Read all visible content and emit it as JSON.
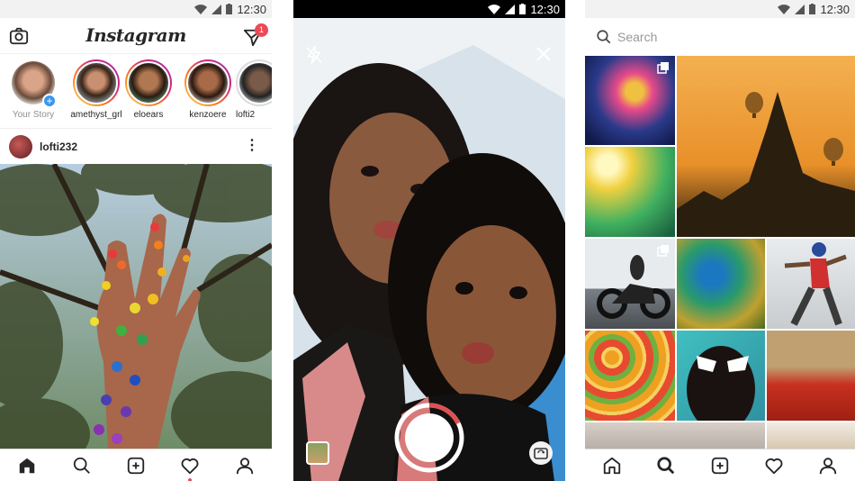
{
  "status_bar": {
    "time": "12:30"
  },
  "feed": {
    "app_title": "Instagram",
    "dm_badge_count": "1",
    "stories": [
      {
        "name": "Your Story"
      },
      {
        "name": "amethyst_grl"
      },
      {
        "name": "eloears"
      },
      {
        "name": "kenzoere"
      },
      {
        "name": "lofti2"
      }
    ],
    "post": {
      "username": "lofti232",
      "more_label": "⋮"
    }
  },
  "camera": {},
  "explore": {
    "search_placeholder": "Search"
  },
  "icons": [
    "camera-icon",
    "direct-message-icon",
    "home-icon",
    "search-icon",
    "new-post-icon",
    "heart-icon",
    "profile-icon",
    "flash-off-icon",
    "close-icon",
    "shutter-button",
    "gallery-thumbnail",
    "flip-camera-icon",
    "multiple-photos-icon"
  ],
  "colors": {
    "accent": "#3897f0",
    "notification": "#ed4956",
    "story_ring": "#d62976"
  }
}
